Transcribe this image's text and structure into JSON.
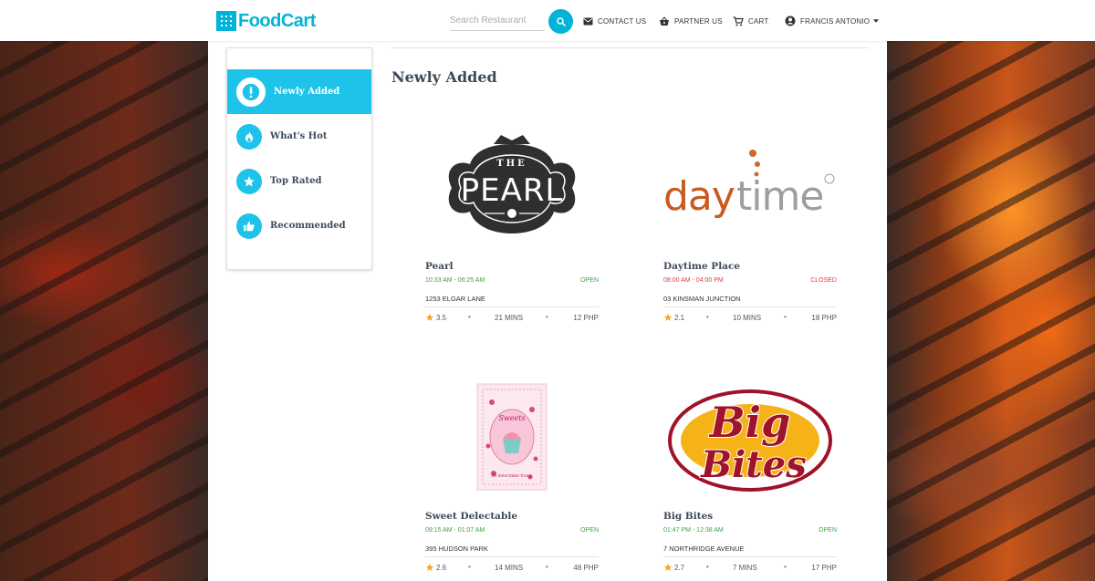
{
  "header": {
    "logo_text": "FoodCart",
    "search_placeholder": "Search Restaurant",
    "nav": {
      "contact": "CONTACT US",
      "partner": "PARTNER US",
      "cart": "CART",
      "user": "FRANCIS ANTONIO"
    }
  },
  "sidebar": {
    "items": [
      {
        "label": "Newly Added",
        "icon": "exclamation-icon",
        "active": true
      },
      {
        "label": "What's Hot",
        "icon": "flame-icon",
        "active": false
      },
      {
        "label": "Top Rated",
        "icon": "star-icon",
        "active": false
      },
      {
        "label": "Recommended",
        "icon": "thumbs-up-icon",
        "active": false
      }
    ]
  },
  "main": {
    "title": "Newly Added",
    "restaurants": [
      {
        "name": "Pearl",
        "logo_text": "THE PEARL",
        "hours": "10:33 AM - 06:25 AM",
        "status": "OPEN",
        "status_color": "#43a047",
        "address": "1253 ELGAR LANE",
        "rating": "3.5",
        "time": "21 MINS",
        "price": "12 PHP"
      },
      {
        "name": "Daytime Place",
        "logo_text": "daytime",
        "hours": "08:00 AM - 04:00 PM",
        "status": "CLOSED",
        "status_color": "#e53935",
        "address": "03 KINSMAN JUNCTION",
        "rating": "2.1",
        "time": "10 MINS",
        "price": "18 PHP"
      },
      {
        "name": "Sweet Delectable",
        "logo_text": "Sweets",
        "hours": "09:15 AM - 01:07 AM",
        "status": "OPEN",
        "status_color": "#43a047",
        "address": "395 HUDSON PARK",
        "rating": "2.6",
        "time": "14 MINS",
        "price": "48 PHP"
      },
      {
        "name": "Big Bites",
        "logo_text": "Big Bites",
        "hours": "01:47 PM - 12:38 AM",
        "status": "OPEN",
        "status_color": "#43a047",
        "address": "7 NORTHRIDGE AVENUE",
        "rating": "2.7",
        "time": "7 MINS",
        "price": "17 PHP"
      }
    ]
  },
  "colors": {
    "accent": "#1ec3ea",
    "open": "#43a047",
    "closed": "#e53935",
    "star": "#f5a623"
  }
}
